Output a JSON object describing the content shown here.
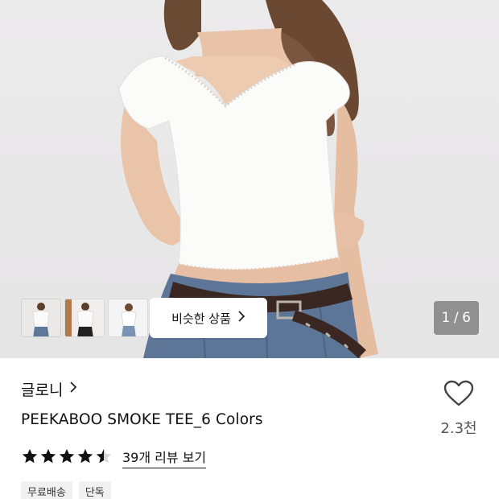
{
  "gallery": {
    "similar_button_label": "비슷한 상품",
    "counter_current": "1",
    "counter_separator": "/",
    "counter_total": "6",
    "thumbnail_count": 3
  },
  "product": {
    "brand": "글로니",
    "title": "PEEKABOO SMOKE TEE_6 Colors",
    "rating": 4.5,
    "review_link": "39개 리뷰 보기",
    "like_count": "2.3천",
    "tags": [
      "무료배송",
      "단독"
    ]
  },
  "colors": {
    "star": "#111111",
    "tag_bg": "#f1f1f1"
  }
}
